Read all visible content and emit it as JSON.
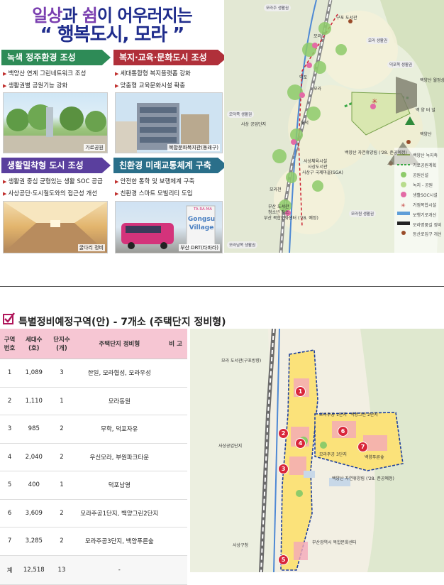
{
  "vision": {
    "title_line1_part1": "일상",
    "title_line1_part2": "과 ",
    "title_line1_part3": "쉼",
    "title_line1_part4": "이 어우러지는",
    "title_line2": "“ 행복도시, 모라 ”"
  },
  "sections": [
    {
      "heading": "녹색 정주환경 조성",
      "bullets": [
        "백양산 연계 그린네트워크 조성",
        "생활권별 공원기능 강화"
      ],
      "caption": "가로공원"
    },
    {
      "heading": "복지·교육·문화도시 조성",
      "bullets": [
        "세대통합형 복지플랫폼 강화",
        "맞춤형 교육문화시설 확충"
      ],
      "caption": "복합문화복지관(동래구)"
    },
    {
      "heading": "생활밀착형 도시 조성",
      "bullets": [
        "생활권 중심 균형있는 생활 SOC 공급",
        "사상공단·도시철도와의 접근성 개선"
      ],
      "caption": "굴다리 정비"
    },
    {
      "heading": "친환경 미래교통체계 구축",
      "bullets": [
        "안전한 통학 및 보행체계 구축",
        "친환경 스마트 모빌리티 도입"
      ],
      "caption": "부산 DRT(타바라)"
    }
  ],
  "bus_sign": {
    "line1": "TA·RA·MA",
    "line2": "Gongsu",
    "line3": "Village"
  },
  "top_map": {
    "labels": [
      "모라주 생활권",
      "구포 도서관",
      "모라",
      "모라 생활권",
      "덕포",
      "모덕",
      "모라",
      "백양산 월정상",
      "백양산",
      "백 양 터 널",
      "사상 공업단지",
      "모덕쪽 생활권",
      "사상체육시설",
      "사상도서관",
      "사상구 국제마을(SGA)",
      "백양산 자연휴양림 ('28. 준공예정)",
      "부산 도서관",
      "청소년 장소",
      "부산 복합문화센터 ('28. 예정)",
      "모라원 생활권",
      "덕포쪽 생활권",
      "모라남쪽 생활권",
      "모라천"
    ],
    "legend": [
      "백양산 녹지축",
      "가로공원계획",
      "공원신설",
      "녹지 - 공원",
      "생활SOC시설",
      "거점복합시설",
      "보행기로개선",
      "모라명품길 정비",
      "등산로입구 개선"
    ]
  },
  "bottom": {
    "title": "특별정비예정구역(안) - 7개소 (주택단지 정비형)",
    "table": {
      "headers": [
        "구역 번호",
        "세대수 (호)",
        "단지수 (개)",
        "주택단지 정비형",
        "비 고"
      ],
      "rows": [
        [
          "1",
          "1,089",
          "3",
          "한일, 모라협성, 모라우성",
          ""
        ],
        [
          "2",
          "1,110",
          "1",
          "모라동원",
          ""
        ],
        [
          "3",
          "985",
          "2",
          "무학, 덕포자유",
          ""
        ],
        [
          "4",
          "2,040",
          "2",
          "우신모라, 부원파크타운",
          ""
        ],
        [
          "5",
          "400",
          "1",
          "덕포남영",
          ""
        ],
        [
          "6",
          "3,609",
          "2",
          "모라주공1단지, 백양그린2단지",
          ""
        ],
        [
          "7",
          "3,285",
          "2",
          "모라주공3단지, 백양푸른숲",
          ""
        ]
      ],
      "total": [
        "계",
        "12,518",
        "13",
        "-",
        ""
      ]
    },
    "map_numbers": [
      "1",
      "2",
      "3",
      "4",
      "5",
      "6",
      "7"
    ],
    "map_labels": [
      "모라 도서관(구포방향)",
      "사상공업단지",
      "모라주공 1단지",
      "백양그린 2단지",
      "모라주공 3단지",
      "백양푸른숲",
      "백양산 자연휴양림 ('28. 준공예정)",
      "부산광역시 복합문화센터",
      "사상구청"
    ]
  }
}
